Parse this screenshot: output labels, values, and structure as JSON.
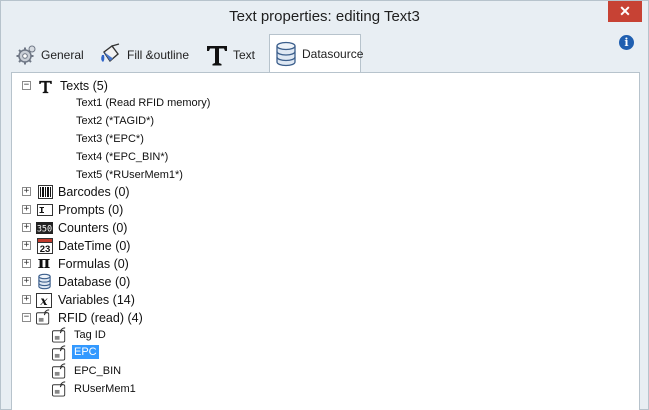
{
  "window": {
    "title": "Text properties: editing Text3",
    "close_glyph": "✕"
  },
  "tabs": [
    {
      "label": "General",
      "icon": "gear-icon"
    },
    {
      "label": "Fill &outline",
      "icon": "paint-bucket-icon"
    },
    {
      "label": "Text",
      "icon": "text-t-icon"
    },
    {
      "label": "Datasource",
      "icon": "database-icon",
      "active": true
    }
  ],
  "info_glyph": "i",
  "tree": {
    "texts": {
      "label": "Texts (5)",
      "expander": "−",
      "icon": "text-t-icon",
      "children": [
        "Text1 (Read RFID memory)",
        "Text2 (*TAGID*)",
        "Text3 (*EPC*)",
        "Text4 (*EPC_BIN*)",
        "Text5 (*RUserMem1*)"
      ]
    },
    "barcodes": {
      "label": "Barcodes (0)",
      "expander": "+",
      "icon": "barcode-icon"
    },
    "prompts": {
      "label": "Prompts (0)",
      "expander": "+",
      "icon": "prompt-icon"
    },
    "counters": {
      "label": "Counters (0)",
      "expander": "+",
      "icon": "counter-icon",
      "icon_text": "350"
    },
    "datetime": {
      "label": "DateTime (0)",
      "expander": "+",
      "icon": "calendar-icon",
      "icon_text": "23"
    },
    "formulas": {
      "label": "Formulas (0)",
      "expander": "+",
      "icon": "pi-icon",
      "icon_text": "π"
    },
    "database": {
      "label": "Database (0)",
      "expander": "+",
      "icon": "database-icon"
    },
    "variables": {
      "label": "Variables (14)",
      "expander": "+",
      "icon": "variable-x-icon",
      "icon_text": "x"
    },
    "rfid": {
      "label": "RFID (read) (4)",
      "expander": "−",
      "icon": "rfid-icon",
      "children": [
        {
          "label": "Tag ID"
        },
        {
          "label": "EPC",
          "selected": true
        },
        {
          "label": "EPC_BIN"
        },
        {
          "label": "RUserMem1"
        }
      ]
    }
  },
  "colors": {
    "selection": "#3399ff",
    "close_button": "#c74234",
    "window_bg": "#e8eef3"
  }
}
